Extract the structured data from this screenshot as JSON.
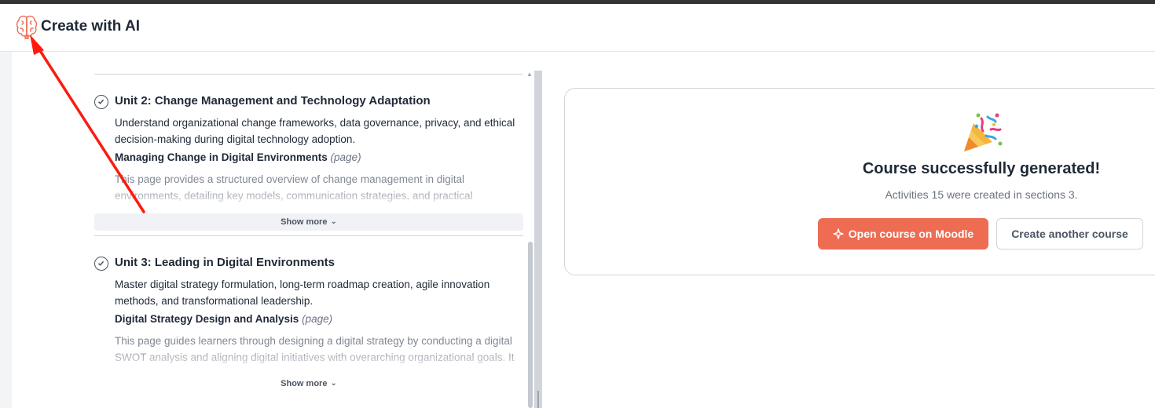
{
  "header": {
    "title": "Create with AI",
    "icon": "brain-icon",
    "accent": "#ee6c52"
  },
  "units": [
    {
      "title": "Unit 2: Change Management and Technology Adaptation",
      "description": "Understand organizational change frameworks, data governance, privacy, and ethical decision-making during digital technology adoption.",
      "activity_title": "Managing Change in Digital Environments",
      "activity_type": "(page)",
      "activity_description": "This page provides a structured overview of change management in digital environments, detailing key models, communication strategies, and practical",
      "show_more": "Show more"
    },
    {
      "title": "Unit 3: Leading in Digital Environments",
      "description": "Master digital strategy formulation, long-term roadmap creation, agile innovation methods, and transformational leadership.",
      "activity_title": "Digital Strategy Design and Analysis",
      "activity_type": "(page)",
      "activity_description": "This page guides learners through designing a digital strategy by conducting a digital SWOT analysis and aligning digital initiatives with overarching organizational goals. It",
      "show_more": "Show more"
    }
  ],
  "result": {
    "icon": "party-popper-icon",
    "headline": "Course successfully generated!",
    "summary": "Activities 15 were created in sections 3.",
    "primary_button": "Open course on Moodle",
    "secondary_button": "Create another course",
    "primary_color": "#ee6c52"
  },
  "annotation": {
    "color": "#ff1a0d"
  }
}
